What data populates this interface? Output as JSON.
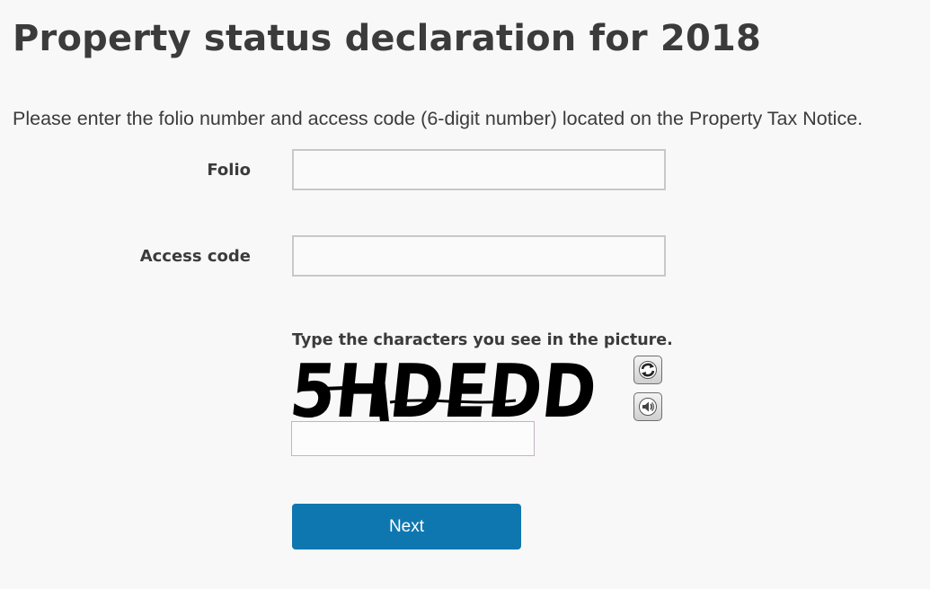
{
  "page": {
    "title": "Property status declaration for 2018",
    "instructions": "Please enter the folio number and access code (6-digit number) located on the Property Tax Notice."
  },
  "form": {
    "folio": {
      "label": "Folio",
      "value": ""
    },
    "access_code": {
      "label": "Access code",
      "value": ""
    },
    "captcha": {
      "prompt": "Type the characters you see in the picture.",
      "image_text": "5HDEDD",
      "input_value": "",
      "refresh_icon": "refresh-icon",
      "audio_icon": "speaker-icon"
    },
    "next_label": "Next"
  },
  "colors": {
    "background": "#f9f8f8",
    "text": "#3b3b3b",
    "button": "#0f77b0",
    "button_text": "#ffffff",
    "input_border": "#c9c7c9"
  }
}
